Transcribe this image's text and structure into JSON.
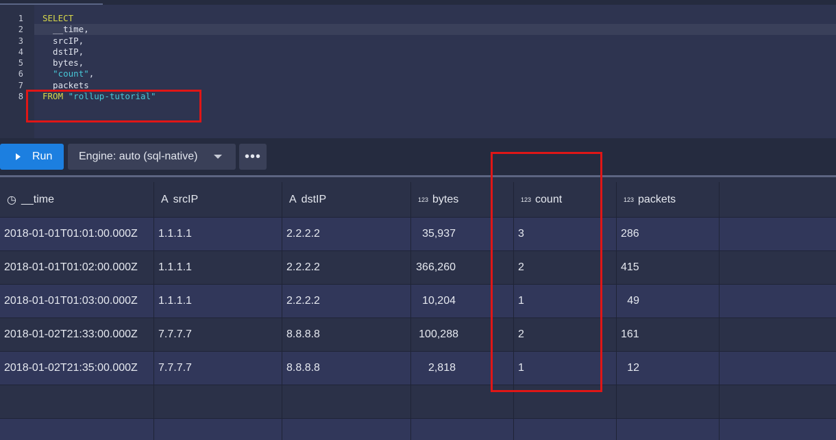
{
  "editor": {
    "lines": [
      {
        "num": "1",
        "text": "SELECT",
        "kind": "keyword"
      },
      {
        "num": "2",
        "text": "  __time,",
        "kind": "plain"
      },
      {
        "num": "3",
        "text": "  srcIP,",
        "kind": "plain"
      },
      {
        "num": "4",
        "text": "  dstIP,",
        "kind": "plain"
      },
      {
        "num": "5",
        "text": "  bytes,",
        "kind": "plain"
      },
      {
        "num": "6",
        "text": "  \"count\",",
        "kind": "string_line"
      },
      {
        "num": "7",
        "text": "  packets",
        "kind": "plain"
      },
      {
        "num": "8",
        "text": "FROM \"rollup-tutorial\"",
        "kind": "from_line"
      }
    ],
    "line6_prefix": "  ",
    "line6_string": "\"count\"",
    "line6_suffix": ",",
    "line8_keyword": "FROM",
    "line8_string": "\"rollup-tutorial\""
  },
  "toolbar": {
    "run_label": "Run",
    "engine_label": "Engine: auto (sql-native)",
    "more_label": "•••"
  },
  "table": {
    "columns": [
      {
        "label": "__time",
        "icon": "clock-icon",
        "icon_glyph": "◷"
      },
      {
        "label": "srcIP",
        "icon": "string-type-icon",
        "icon_glyph": "A"
      },
      {
        "label": "dstIP",
        "icon": "string-type-icon",
        "icon_glyph": "A"
      },
      {
        "label": "bytes",
        "icon": "number-type-icon",
        "icon_glyph": "123"
      },
      {
        "label": "count",
        "icon": "number-type-icon",
        "icon_glyph": "123"
      },
      {
        "label": "packets",
        "icon": "number-type-icon",
        "icon_glyph": "123"
      }
    ],
    "rows": [
      [
        "2018-01-01T01:01:00.000Z",
        "1.1.1.1",
        "2.2.2.2",
        "35,937",
        "3",
        "286"
      ],
      [
        "2018-01-01T01:02:00.000Z",
        "1.1.1.1",
        "2.2.2.2",
        "366,260",
        "2",
        "415"
      ],
      [
        "2018-01-01T01:03:00.000Z",
        "1.1.1.1",
        "2.2.2.2",
        "10,204",
        "1",
        "49"
      ],
      [
        "2018-01-02T21:33:00.000Z",
        "7.7.7.7",
        "8.8.8.8",
        "100,288",
        "2",
        "161"
      ],
      [
        "2018-01-02T21:35:00.000Z",
        "7.7.7.7",
        "8.8.8.8",
        "2,818",
        "1",
        "12"
      ]
    ]
  },
  "colors": {
    "run_button": "#1c7fe0",
    "highlight_box": "#e01616",
    "keyword": "#d8d84a",
    "string": "#48c8d8"
  }
}
